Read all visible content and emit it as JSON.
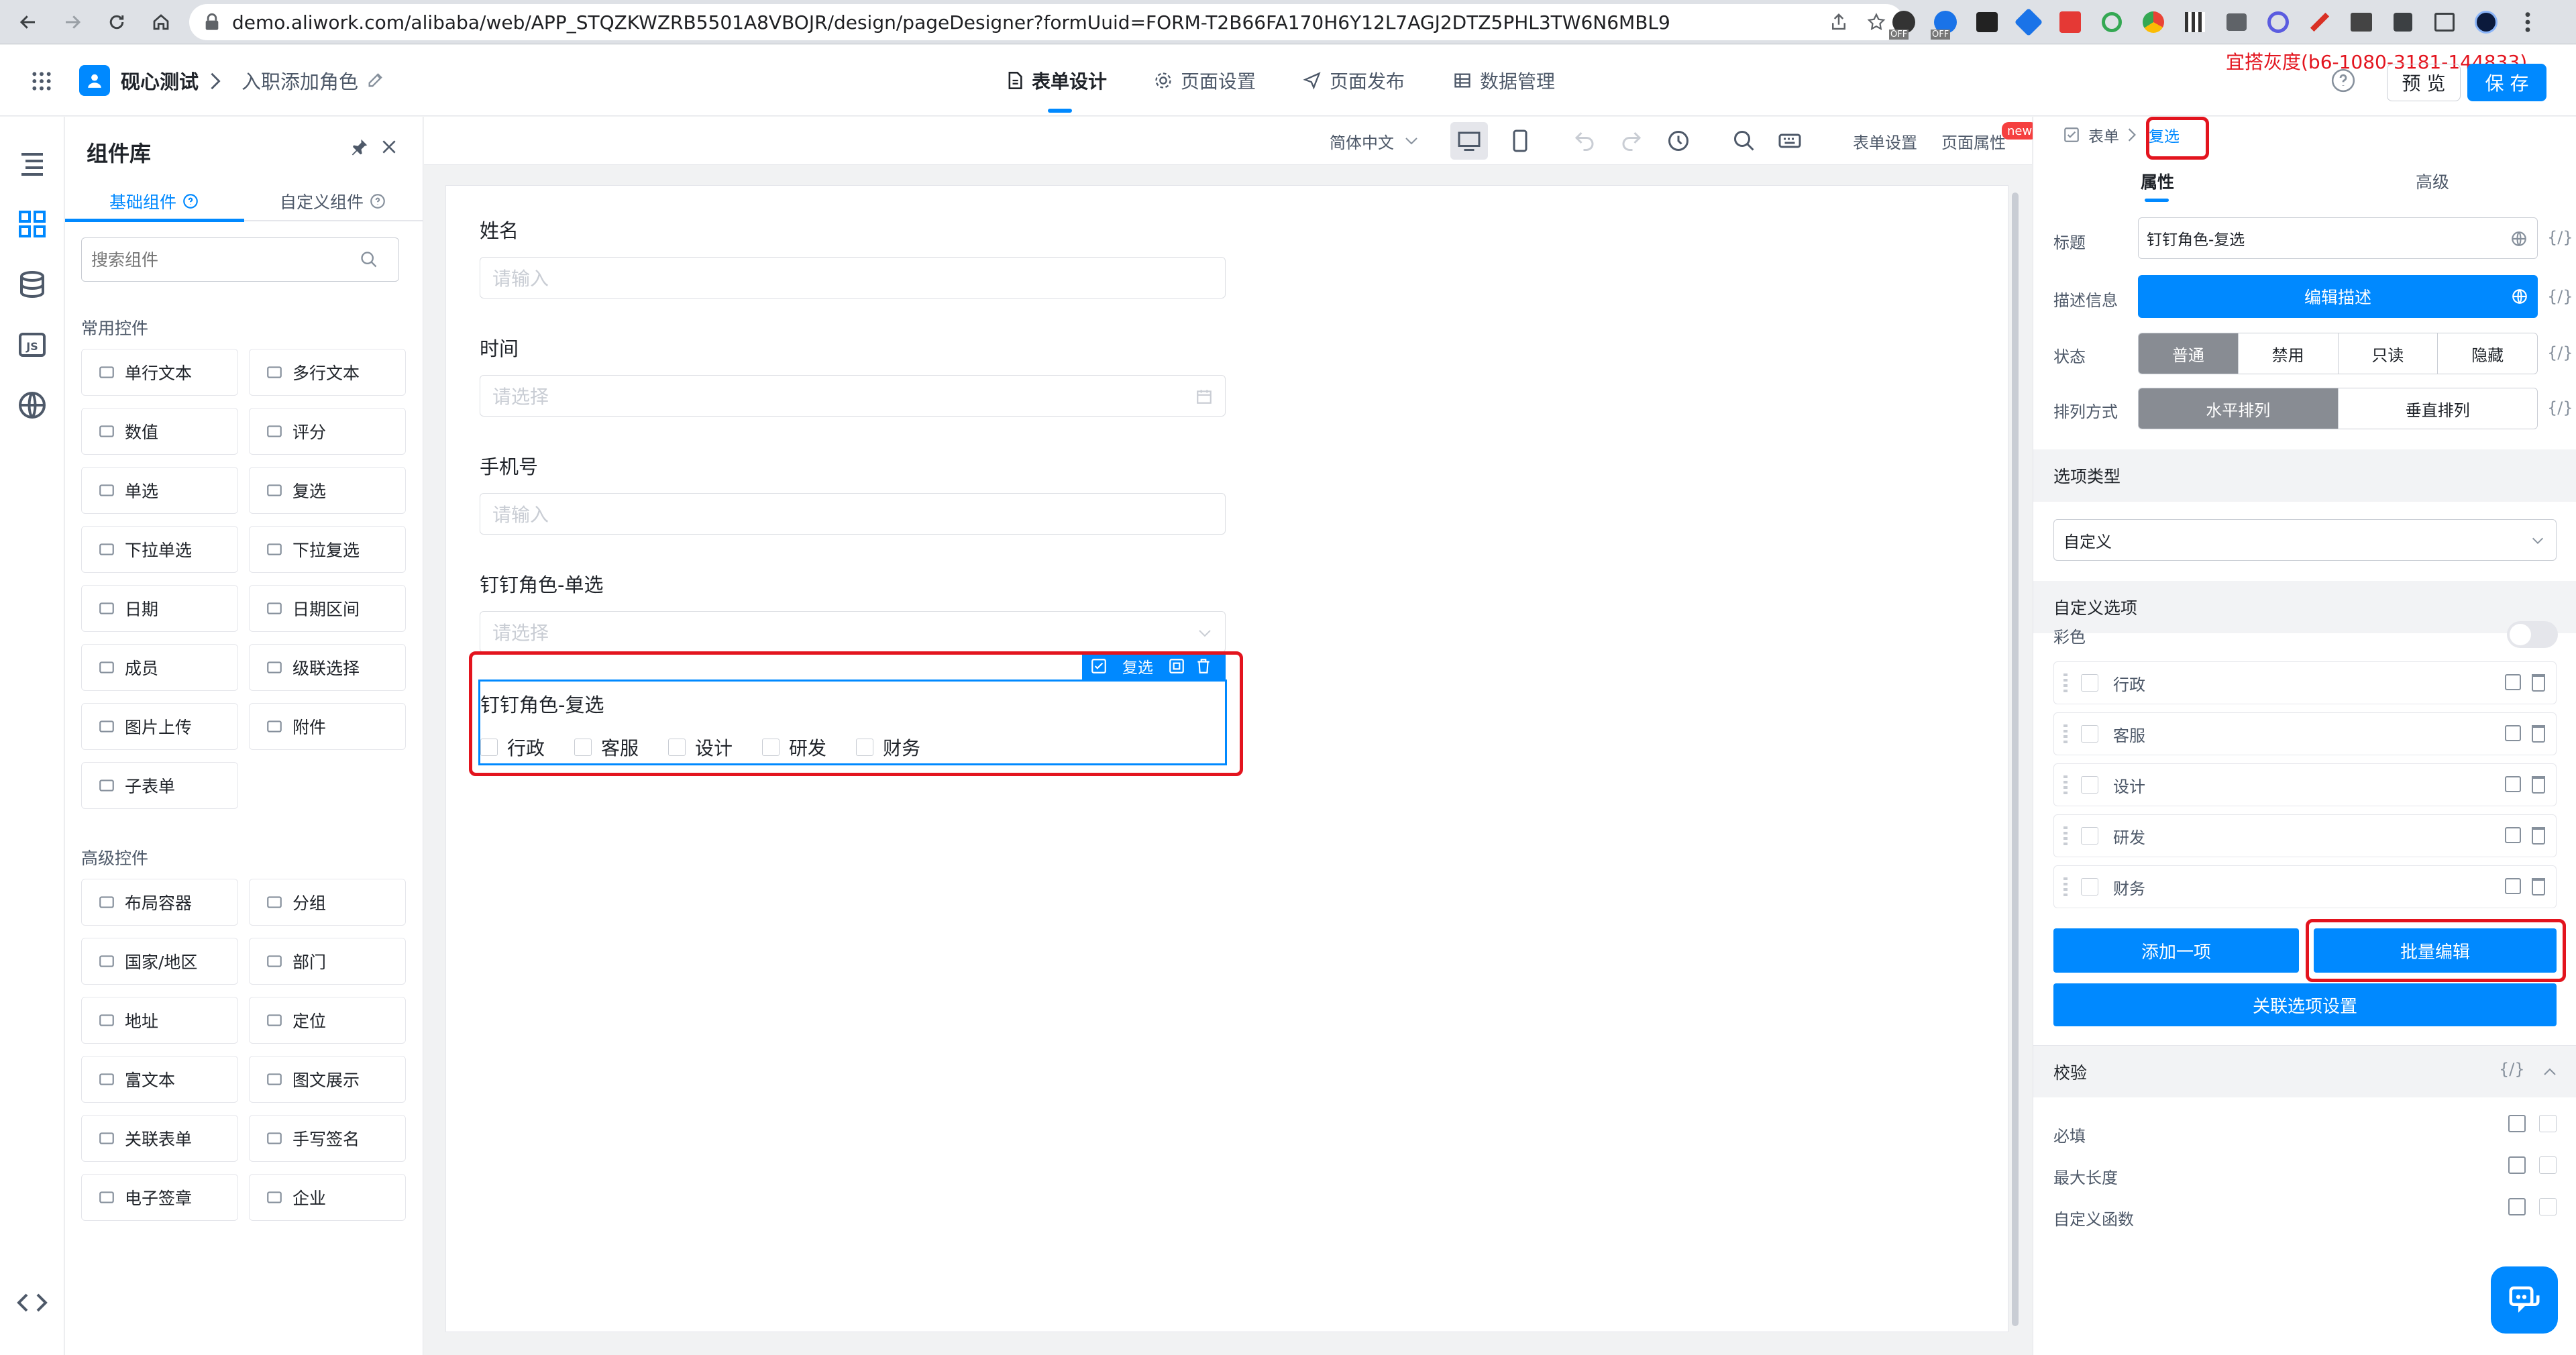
{
  "browser": {
    "url": "demo.aliwork.com/alibaba/web/APP_STQZKWZRB5501A8VBOJR/design/pageDesigner?formUuid=FORM-T2B66FA170H6Y12L7AGJ2DTZ5PHL3TW6N6MBL9",
    "ext_off_label": "OFF"
  },
  "header": {
    "app_name": "砚心测试",
    "breadcrumb_page": "入职添加角色",
    "tabs": [
      "表单设计",
      "页面设置",
      "页面发布",
      "数据管理"
    ],
    "env_label": "宜搭灰度(b6-1080-3181-144833)",
    "preview_label": "预 览",
    "save_label": "保 存"
  },
  "components": {
    "title": "组件库",
    "tabs": [
      "基础组件",
      "自定义组件"
    ],
    "search_placeholder": "搜索组件",
    "common_title": "常用控件",
    "common": [
      "单行文本",
      "多行文本",
      "数值",
      "评分",
      "单选",
      "复选",
      "下拉单选",
      "下拉复选",
      "日期",
      "日期区间",
      "成员",
      "级联选择",
      "图片上传",
      "附件",
      "子表单"
    ],
    "advanced_title": "高级控件",
    "advanced": [
      "布局容器",
      "分组",
      "国家/地区",
      "部门",
      "地址",
      "定位",
      "富文本",
      "图文展示",
      "关联表单",
      "手写签名",
      "电子签章",
      "企业"
    ]
  },
  "toolbar": {
    "language": "简体中文",
    "form_settings": "表单设置",
    "page_props": "页面属性",
    "new_badge": "new"
  },
  "form": {
    "fields": [
      {
        "label": "姓名",
        "placeholder": "请输入"
      },
      {
        "label": "时间",
        "placeholder": "请选择"
      },
      {
        "label": "手机号",
        "placeholder": "请输入"
      },
      {
        "label": "钉钉角色-单选",
        "placeholder": "请选择"
      }
    ],
    "selected_field": {
      "label": "钉钉角色-复选",
      "badge": "复选",
      "options": [
        "行政",
        "客服",
        "设计",
        "研发",
        "财务"
      ]
    }
  },
  "props": {
    "breadcrumb_root": "表单",
    "breadcrumb_current": "复选",
    "tabs": [
      "属性",
      "高级"
    ],
    "title_label": "标题",
    "title_value": "钉钉角色-复选",
    "desc_label": "描述信息",
    "desc_button": "编辑描述",
    "state_label": "状态",
    "state_options": [
      "普通",
      "禁用",
      "只读",
      "隐藏"
    ],
    "layout_label": "排列方式",
    "layout_options": [
      "水平排列",
      "垂直排列"
    ],
    "option_type_title": "选项类型",
    "option_type_value": "自定义",
    "custom_options_title": "自定义选项",
    "color_label": "彩色",
    "options": [
      "行政",
      "客服",
      "设计",
      "研发",
      "财务"
    ],
    "add_item": "添加一项",
    "batch_edit": "批量编辑",
    "link_options": "关联选项设置",
    "validation_title": "校验",
    "required_label": "必填",
    "maxlen_label": "最大长度",
    "custom_func_label": "自定义函数",
    "brace_text": "{/}"
  }
}
